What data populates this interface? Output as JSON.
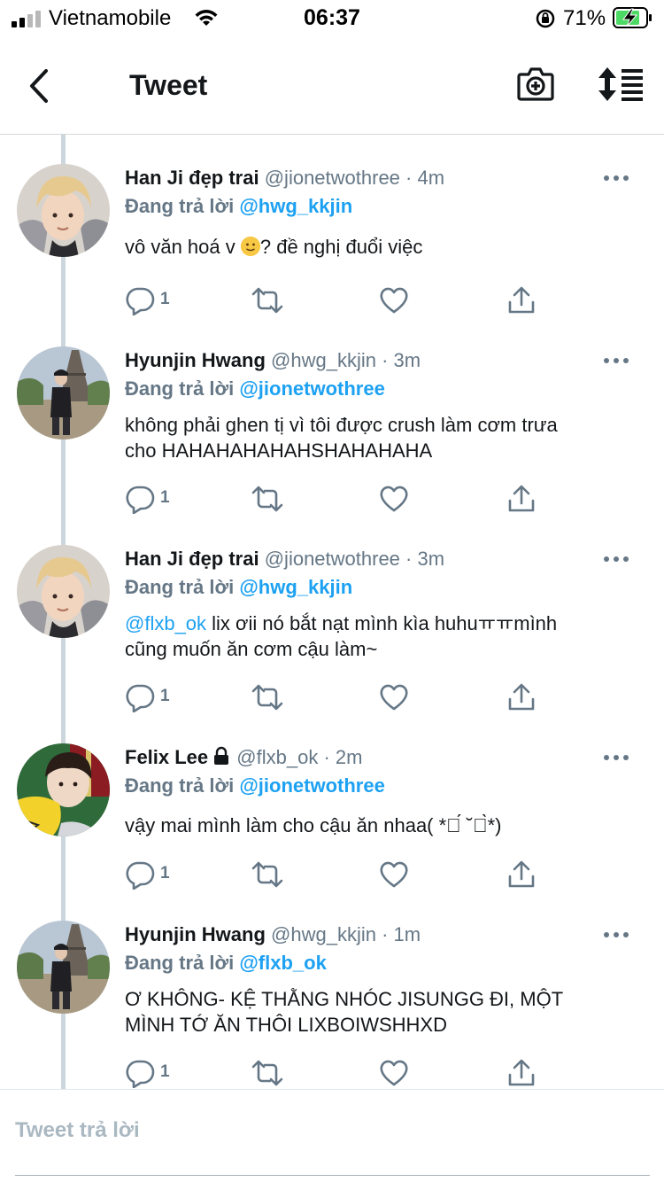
{
  "status_bar": {
    "carrier": "Vietnamobile",
    "time": "06:37",
    "battery_percent": "71%"
  },
  "nav": {
    "title": "Tweet"
  },
  "tweets": [
    {
      "name": "Han Ji đẹp trai",
      "handle": "@jionetwothree",
      "dot": "·",
      "time": "4m",
      "replying_label": "Đang trả lời",
      "replying_to": "@hwg_kkjin",
      "body_before": "vô văn hoá v ",
      "body_after": "? đề nghị đuổi việc",
      "reply_count": "1",
      "avatar": "avatar-blonde"
    },
    {
      "name": "Hyunjin Hwang",
      "handle": "@hwg_kkjin",
      "dot": "·",
      "time": "3m",
      "replying_label": "Đang trả lời",
      "replying_to": "@jionetwothree",
      "body_line1": "không phải ghen tị vì tôi được crush làm cơm trưa",
      "body_line2": "cho HAHAHAHAHAHSHAHAHAHA",
      "reply_count": "1",
      "avatar": "avatar-paris"
    },
    {
      "name": "Han Ji đẹp trai",
      "handle": "@jionetwothree",
      "dot": "·",
      "time": "3m",
      "replying_label": "Đang trả lời",
      "replying_to": "@hwg_kkjin",
      "body_mention": "@flxb_ok",
      "body_line1": " lix ơii nó bắt nạt mình kìa huhuㅠㅠmình",
      "body_line2": "cũng muốn ăn cơm cậu làm~",
      "reply_count": "1",
      "avatar": "avatar-blonde"
    },
    {
      "name": "Felix Lee",
      "handle": "@flxb_ok",
      "dot": "·",
      "time": "2m",
      "replying_label": "Đang trả lời",
      "replying_to": "@jionetwothree",
      "body_line1": "vậy mai mình làm cho cậu ăn nhaa( *ต́ ˘ต̀*)",
      "reply_count": "1",
      "avatar": "avatar-felix"
    },
    {
      "name": "Hyunjin Hwang",
      "handle": "@hwg_kkjin",
      "dot": "·",
      "time": "1m",
      "replying_label": "Đang trả lời",
      "replying_to": "@flxb_ok",
      "body_line1": "Ơ KHÔNG- KỆ THẰNG NHÓC JISUNGG ĐI, MỘT",
      "body_line2": "MÌNH TỚ ĂN THÔI LIXBOIWSHHXD",
      "reply_count": "1",
      "avatar": "avatar-paris"
    }
  ],
  "reply_bar": {
    "placeholder": "Tweet trả lời"
  },
  "colors": {
    "accent": "#1da1f2",
    "secondary_text": "#657786",
    "primary_text": "#14171a",
    "thread_line": "#ccd6dd"
  },
  "icons": [
    "back-chevron-icon",
    "camera-plus-icon",
    "sort-icon",
    "reply-icon",
    "retweet-icon",
    "like-icon",
    "share-icon",
    "more-icon",
    "lock-icon"
  ]
}
